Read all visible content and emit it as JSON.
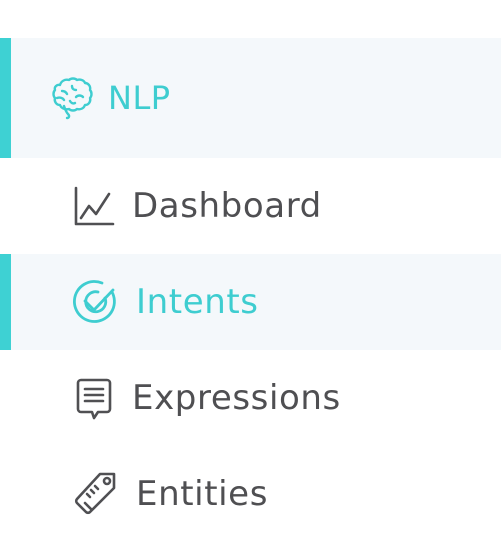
{
  "nav": {
    "section": {
      "label": "NLP",
      "icon": "brain-icon",
      "active": true
    },
    "items": [
      {
        "label": "Dashboard",
        "icon": "line-chart-icon",
        "active": false
      },
      {
        "label": "Intents",
        "icon": "target-check-icon",
        "active": true
      },
      {
        "label": "Expressions",
        "icon": "note-icon",
        "active": false
      },
      {
        "label": "Entities",
        "icon": "tag-icon",
        "active": false
      }
    ]
  },
  "colors": {
    "accent": "#3ed1d3",
    "text": "#4f4f52",
    "active_background": "#f4f8fb"
  }
}
